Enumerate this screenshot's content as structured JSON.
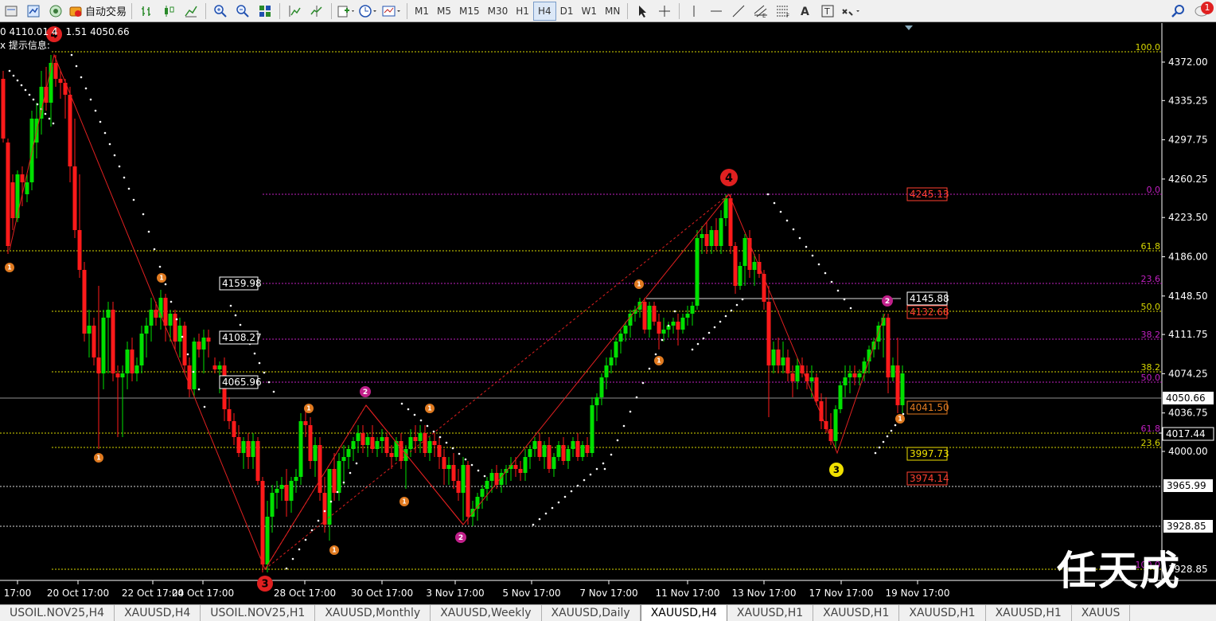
{
  "toolbar": {
    "auto_trade_label": "自动交易",
    "timeframes": [
      "M1",
      "M5",
      "M15",
      "M30",
      "H1",
      "H4",
      "D1",
      "W1",
      "MN"
    ],
    "active_timeframe": "H4",
    "notification_count": "1"
  },
  "chart": {
    "info_line": "0 4110.01 4",
    "info_line_suffix": "1.51 4050.66",
    "info_hint": "x 提示信息:",
    "current_price": "4050.66",
    "price_axis": [
      "4372.00",
      "4335.25",
      "4297.75",
      "4260.25",
      "4223.50",
      "4186.00",
      "4148.50",
      "4111.75",
      "4074.25",
      "4036.75",
      "4000.00",
      "3965.99",
      "3928.85",
      "3928.85"
    ],
    "price_axis_values": [
      4372.0,
      4335.25,
      4297.75,
      4260.25,
      4223.5,
      4186.0,
      4148.5,
      4111.75,
      4074.25,
      4036.75,
      4000.0
    ],
    "time_axis": [
      "17:00",
      "20 Oct 17:00",
      "22 Oct 17:00",
      "24 Oct 17:00",
      "28 Oct 17:00",
      "30 Oct 17:00",
      "3 Nov 17:00",
      "5 Nov 17:00",
      "7 Nov 17:00",
      "11 Nov 17:00",
      "13 Nov 17:00",
      "17 Nov 17:00",
      "19 Nov 17:00"
    ],
    "fib_levels_right": [
      "100.0",
      "0.0",
      "61.8",
      "23.6",
      "50.0",
      "38.2",
      "38.2",
      "50.0",
      "61.8",
      "23.6",
      "100.0"
    ],
    "price_boxes": [
      "4245.13",
      "4145.88",
      "4132.68",
      "4041.50",
      "3997.73",
      "3974.14",
      "4017.44",
      "3965.99",
      "3928.85"
    ],
    "left_boxes": [
      "4159.98",
      "4108.27",
      "4065.96"
    ],
    "wave_labels": [
      "1",
      "2",
      "3",
      "4"
    ],
    "colors": {
      "bull": "#00e000",
      "bear": "#ff1a1a",
      "fib_magenta": "#c020c0",
      "fib_yellow": "#d8d800",
      "wave_orange": "#e07a20",
      "zigzag": "#e02020"
    }
  },
  "watermark": "任天成",
  "tabs": [
    "USOIL.NOV25,H4",
    "XAUUSD,H4",
    "USOIL.NOV25,H1",
    "XAUUSD,Monthly",
    "XAUUSD,Weekly",
    "XAUUSD,Daily",
    "XAUUSD,H4",
    "XAUUSD,H1",
    "XAUUSD,H1",
    "XAUUSD,H1",
    "XAUUSD,H1",
    "XAUUS"
  ],
  "active_tab_index": 6
}
